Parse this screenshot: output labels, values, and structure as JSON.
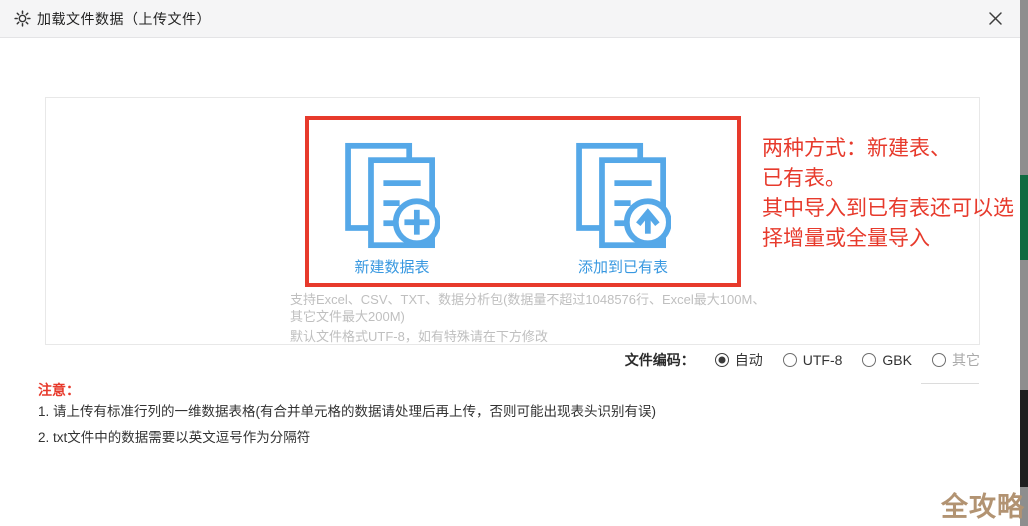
{
  "window": {
    "title": "加载文件数据（上传文件）"
  },
  "upload_options": [
    {
      "label": "新建数据表",
      "icon": "documents-plus-icon"
    },
    {
      "label": "添加到已有表",
      "icon": "documents-upload-arrow-icon"
    }
  ],
  "hints": {
    "line1": "支持Excel、CSV、TXT、数据分析包(数据量不超过1048576行、Excel最大100M、",
    "line2": "其它文件最大200M)",
    "line3": "默认文件格式UTF-8，如有特殊请在下方修改"
  },
  "annotation": {
    "line1": "两种方式：新建表、",
    "line2": "已有表。",
    "line3": "其中导入到已有表还可以选",
    "line4": "择增量或全量导入"
  },
  "encoding": {
    "label": "文件编码：",
    "options": [
      {
        "label": "自动",
        "selected": true
      },
      {
        "label": "UTF-8",
        "selected": false
      },
      {
        "label": "GBK",
        "selected": false
      },
      {
        "label": "其它",
        "selected": false
      }
    ]
  },
  "notes": {
    "title": "注意：",
    "item1": "1. 请上传有标准行列的一维数据表格(有合并单元格的数据请处理后再上传，否则可能出现表头识别有误)",
    "item2": "2. txt文件中的数据需要以英文逗号作为分隔符"
  },
  "watermark": "全攻略",
  "colors": {
    "accent_blue": "#4aa0e4",
    "option_label_blue": "#3898e0",
    "annotation_red": "#e73a2c",
    "hint_gray": "#bfbfbf",
    "watermark_gold": "#b29372",
    "edge_gray": "#8e8e8e",
    "edge_green": "#0f6b41",
    "edge_dark": "#1f1f1f"
  }
}
